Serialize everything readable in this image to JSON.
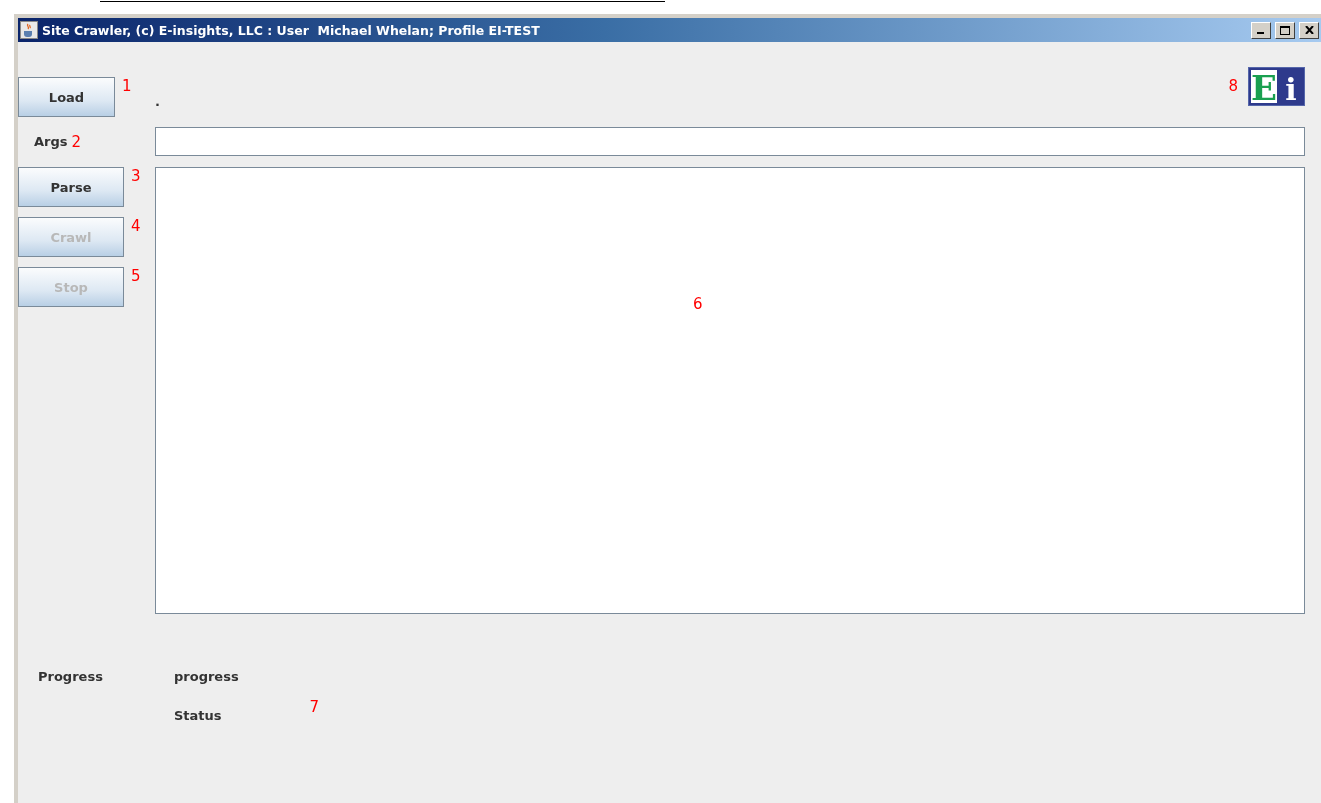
{
  "window": {
    "title": "Site Crawler, (c) E-insights, LLC : User  Michael Whelan; Profile EI-TEST"
  },
  "load": {
    "label": "Load",
    "disabled": false,
    "marker": "1"
  },
  "path_label": ".",
  "logo": {
    "text": "Ei",
    "marker": "8"
  },
  "args": {
    "label": "Args",
    "marker": "2"
  },
  "buttons": [
    {
      "label": "Parse",
      "disabled": false,
      "marker": "3"
    },
    {
      "label": "Crawl",
      "disabled": true,
      "marker": "4"
    },
    {
      "label": "Stop",
      "disabled": true,
      "marker": "5"
    }
  ],
  "output": {
    "marker": "6"
  },
  "progress": {
    "label": "Progress",
    "value": "progress",
    "marker": "7"
  },
  "status": {
    "text": "Status"
  }
}
